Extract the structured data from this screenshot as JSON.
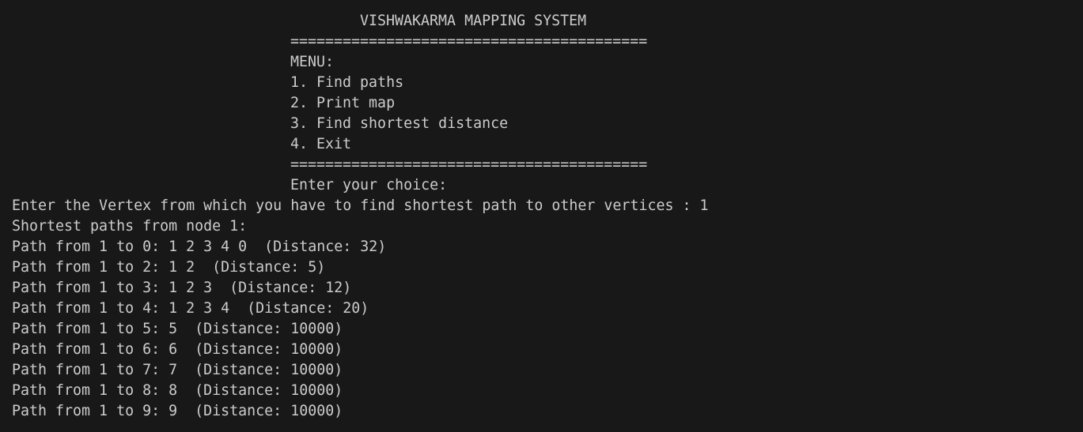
{
  "menu": {
    "title": "VISHWAKARMA MAPPING SYSTEM",
    "separator_top": "=========================================",
    "heading": "MENU:",
    "items": [
      "1. Find paths",
      "2. Print map",
      "3. Find shortest distance",
      "4. Exit"
    ],
    "separator_bottom": "=========================================",
    "prompt": "Enter your choice:"
  },
  "output": {
    "vertex_prompt": "Enter the Vertex from which you have to find shortest path to other vertices : 1",
    "header": "Shortest paths from node 1:",
    "paths": [
      "Path from 1 to 0: 1 2 3 4 0  (Distance: 32)",
      "Path from 1 to 2: 1 2  (Distance: 5)",
      "Path from 1 to 3: 1 2 3  (Distance: 12)",
      "Path from 1 to 4: 1 2 3 4  (Distance: 20)",
      "Path from 1 to 5: 5  (Distance: 10000)",
      "Path from 1 to 6: 6  (Distance: 10000)",
      "Path from 1 to 7: 7  (Distance: 10000)",
      "Path from 1 to 8: 8  (Distance: 10000)",
      "Path from 1 to 9: 9  (Distance: 10000)"
    ]
  }
}
